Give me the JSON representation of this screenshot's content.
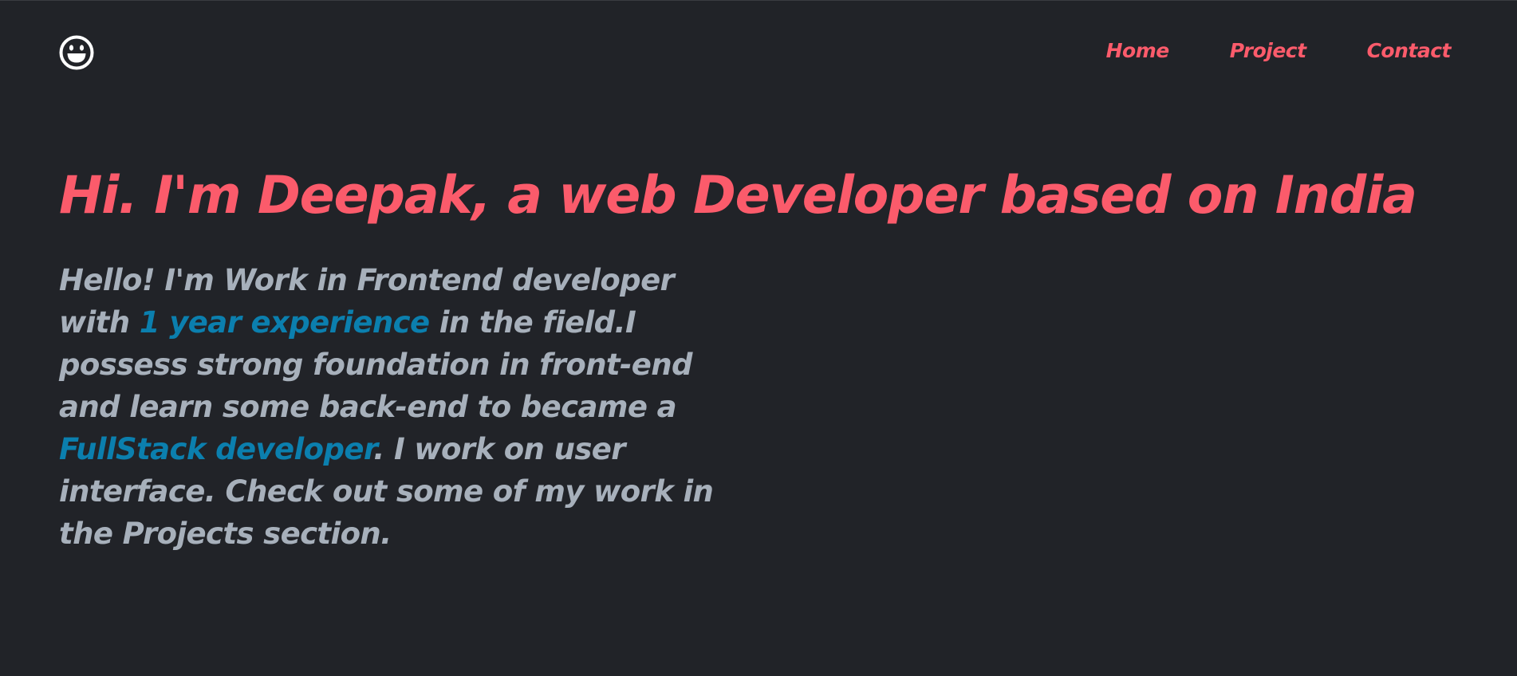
{
  "header": {
    "logo_icon": "smiley-face-icon",
    "nav": [
      {
        "label": "Home"
      },
      {
        "label": "Project"
      },
      {
        "label": "Contact"
      }
    ]
  },
  "hero": {
    "headline": "Hi. I'm Deepak, a web Developer based on India",
    "intro": {
      "part1": "Hello! I'm Work in Frontend developer with ",
      "highlight1": "1 year experience",
      "part2": " in the field.I possess strong foundation in front-end and learn some back-end to became a ",
      "highlight2": "FullStack developer",
      "part3": ". I work on user interface. Check out some of my work in the Projects section."
    }
  },
  "colors": {
    "background": "#212328",
    "accent": "#fb5b6b",
    "body_text": "#a7b0bb",
    "highlight": "#0b7fae",
    "logo": "#ffffff"
  }
}
